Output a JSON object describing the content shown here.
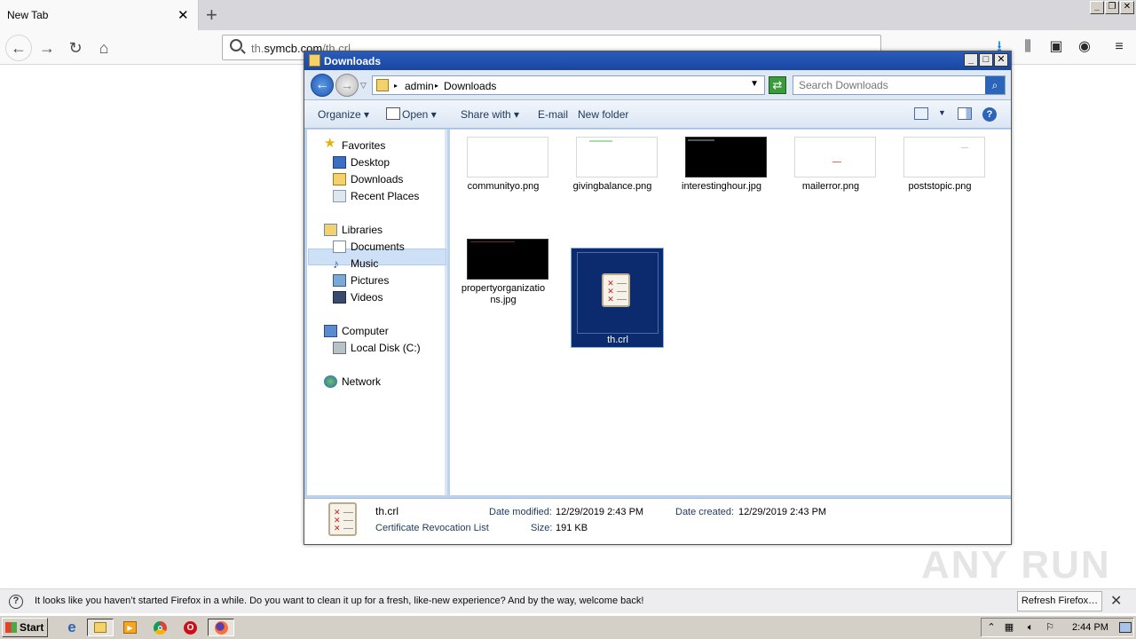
{
  "browser": {
    "tab_title": "New Tab",
    "url_prefix": "th.",
    "url_domain": "symcb.com",
    "url_path": "/th.crl"
  },
  "explorer": {
    "title": "Downloads",
    "breadcrumb": [
      "admin",
      "Downloads"
    ],
    "search_placeholder": "Search Downloads",
    "toolbar": {
      "organize": "Organize",
      "open": "Open",
      "share_with": "Share with",
      "email": "E-mail",
      "new_folder": "New folder"
    },
    "nav": {
      "favorites": "Favorites",
      "desktop": "Desktop",
      "downloads": "Downloads",
      "recent_places": "Recent Places",
      "libraries": "Libraries",
      "documents": "Documents",
      "music": "Music",
      "pictures": "Pictures",
      "videos": "Videos",
      "computer": "Computer",
      "local_disk": "Local Disk (C:)",
      "network": "Network"
    },
    "files": [
      {
        "name": "communityo.png",
        "thumb_color": "#ffffff"
      },
      {
        "name": "givingbalance.png",
        "thumb_color": "#ffffff"
      },
      {
        "name": "interestinghour.jpg",
        "thumb_color": "#000000"
      },
      {
        "name": "mailerror.png",
        "thumb_color": "#ffffff"
      },
      {
        "name": "poststopic.png",
        "thumb_color": "#ffffff"
      },
      {
        "name": "propertyorganizations.jpg",
        "name_line1": "propertyorganizatio",
        "name_line2": "ns.jpg",
        "thumb_color": "#000000"
      },
      {
        "name": "th.crl",
        "selected": true
      }
    ],
    "details": {
      "filename": "th.crl",
      "type": "Certificate Revocation List",
      "date_modified_label": "Date modified:",
      "date_modified": "12/29/2019 2:43 PM",
      "date_created_label": "Date created:",
      "date_created": "12/29/2019 2:43 PM",
      "size_label": "Size:",
      "size": "191 KB"
    }
  },
  "notification": {
    "message": "It looks like you haven’t started Firefox in a while. Do you want to clean it up for a fresh, like-new experience? And by the way, welcome back!",
    "button": "Refresh Firefox…"
  },
  "taskbar": {
    "start": "Start",
    "clock": "2:44 PM"
  },
  "watermark": "ANY RUN",
  "colors": {
    "selection": "#0c2a6e",
    "title_bar": "#1946a4",
    "nav_selected": "#cde0f5"
  }
}
